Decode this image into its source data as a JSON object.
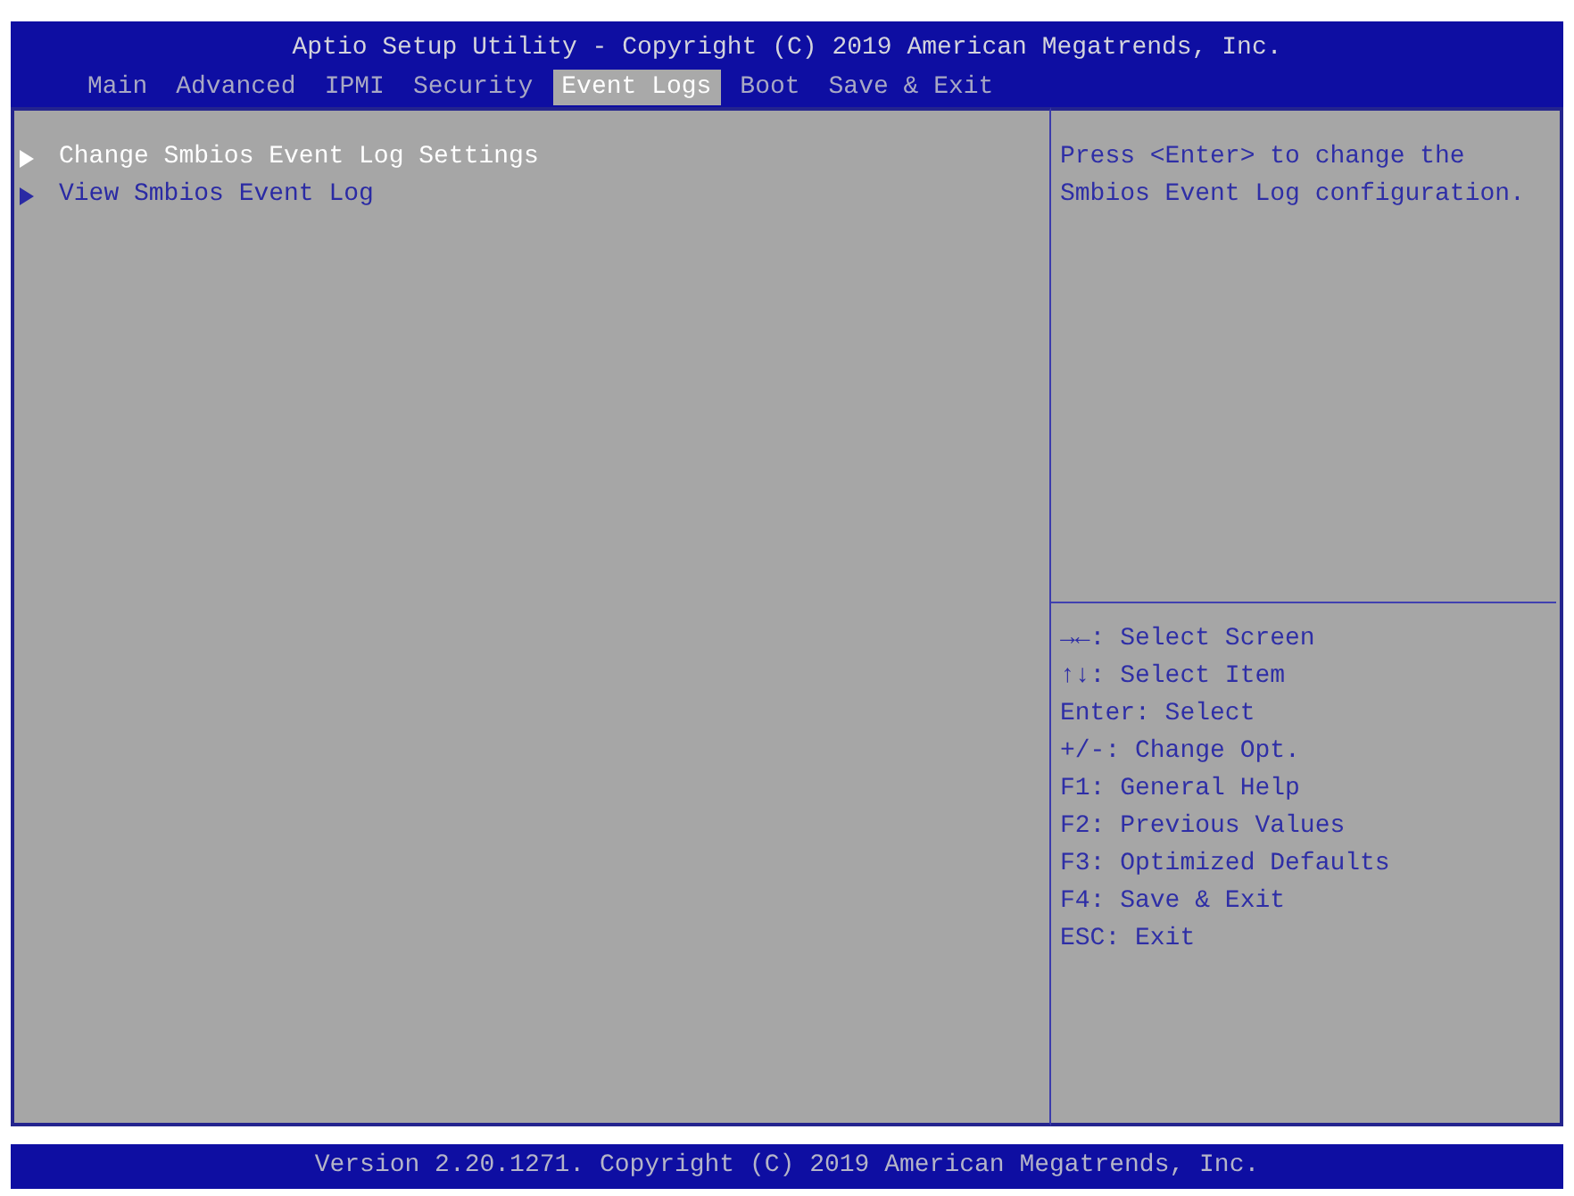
{
  "header": {
    "title": "Aptio Setup Utility - Copyright (C) 2019 American Megatrends, Inc."
  },
  "tabs": [
    {
      "label": "Main",
      "selected": false
    },
    {
      "label": "Advanced",
      "selected": false
    },
    {
      "label": "IPMI",
      "selected": false
    },
    {
      "label": "Security",
      "selected": false
    },
    {
      "label": "Event Logs",
      "selected": true
    },
    {
      "label": "Boot",
      "selected": false
    },
    {
      "label": "Save & Exit",
      "selected": false
    }
  ],
  "menu": {
    "items": [
      {
        "label": "Change Smbios Event Log Settings",
        "selected": true
      },
      {
        "label": "View Smbios Event Log",
        "selected": false
      }
    ]
  },
  "help_panel": {
    "description": "Press <Enter> to change the Smbios Event Log configuration.",
    "key_legend": [
      "→←: Select Screen",
      "↑↓: Select Item",
      "Enter: Select",
      "+/-: Change Opt.",
      "F1: General Help",
      "F2: Previous Values",
      "F3: Optimized Defaults",
      "F4: Save & Exit",
      "ESC: Exit"
    ]
  },
  "footer": {
    "text": "Version 2.20.1271. Copyright (C) 2019 American Megatrends, Inc."
  }
}
